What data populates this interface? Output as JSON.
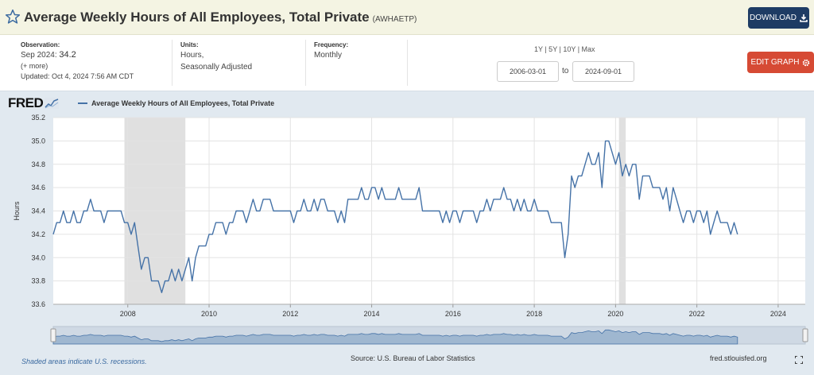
{
  "header": {
    "title": "Average Weekly Hours of All Employees, Total Private",
    "series_id": "(AWHAETP)",
    "download_label": "DOWNLOAD"
  },
  "meta": {
    "observation_label": "Observation:",
    "observation_period": "Sep 2024:",
    "observation_value": "34.2",
    "more_label": "(+ more)",
    "updated": "Updated: Oct 4, 2024 7:56 AM CDT",
    "units_label": "Units:",
    "units_line1": "Hours,",
    "units_line2": "Seasonally Adjusted",
    "frequency_label": "Frequency:",
    "frequency_value": "Monthly",
    "ranges": "1Y | 5Y | 10Y | Max",
    "date_from": "2006-03-01",
    "to_label": "to",
    "date_to": "2024-09-01",
    "edit_label": "EDIT GRAPH"
  },
  "chart": {
    "logo_text": "FRED",
    "legend_label": "Average Weekly Hours of All Employees, Total Private",
    "footer_recessions": "Shaded areas indicate U.S. recessions.",
    "footer_source": "Source: U.S. Bureau of Labor Statistics",
    "footer_site": "fred.stlouisfed.org"
  },
  "colors": {
    "line": "#4572a7",
    "recession": "#e0e0e0",
    "download_button": "#1e3c64",
    "edit_button": "#d64a34",
    "chart_background": "#e1e9f0"
  },
  "chart_data": {
    "type": "line",
    "ylabel": "Hours",
    "xlabel": "",
    "ylim": [
      33.6,
      35.2
    ],
    "yticks": [
      "33.6",
      "33.8",
      "34.0",
      "34.2",
      "34.4",
      "34.6",
      "34.8",
      "35.0",
      "35.2"
    ],
    "xticks": [
      "2008",
      "2010",
      "2012",
      "2014",
      "2016",
      "2018",
      "2020",
      "2022",
      "2024"
    ],
    "x_range": [
      "2006-03",
      "2024-09"
    ],
    "recessions": [
      [
        "2007-12",
        "2009-06"
      ],
      [
        "2020-02",
        "2020-04"
      ]
    ],
    "grid": true,
    "series": [
      {
        "name": "Average Weekly Hours of All Employees, Total Private",
        "x_start": "2006-03",
        "frequency": "monthly",
        "values": [
          34.2,
          34.3,
          34.3,
          34.4,
          34.3,
          34.3,
          34.4,
          34.3,
          34.3,
          34.4,
          34.4,
          34.5,
          34.4,
          34.4,
          34.4,
          34.3,
          34.4,
          34.4,
          34.4,
          34.4,
          34.4,
          34.3,
          34.3,
          34.2,
          34.3,
          34.1,
          33.9,
          34.0,
          34.0,
          33.8,
          33.8,
          33.8,
          33.7,
          33.8,
          33.8,
          33.9,
          33.8,
          33.9,
          33.8,
          33.9,
          34.0,
          33.8,
          34.0,
          34.1,
          34.1,
          34.1,
          34.2,
          34.2,
          34.3,
          34.3,
          34.3,
          34.2,
          34.3,
          34.3,
          34.4,
          34.4,
          34.4,
          34.3,
          34.4,
          34.5,
          34.4,
          34.4,
          34.5,
          34.5,
          34.5,
          34.4,
          34.4,
          34.4,
          34.4,
          34.4,
          34.4,
          34.3,
          34.4,
          34.4,
          34.5,
          34.4,
          34.4,
          34.5,
          34.4,
          34.5,
          34.5,
          34.4,
          34.4,
          34.4,
          34.3,
          34.4,
          34.3,
          34.5,
          34.5,
          34.5,
          34.5,
          34.6,
          34.5,
          34.5,
          34.6,
          34.6,
          34.5,
          34.6,
          34.5,
          34.5,
          34.5,
          34.5,
          34.6,
          34.5,
          34.5,
          34.5,
          34.5,
          34.5,
          34.6,
          34.4,
          34.4,
          34.4,
          34.4,
          34.4,
          34.4,
          34.3,
          34.4,
          34.3,
          34.4,
          34.4,
          34.3,
          34.4,
          34.4,
          34.4,
          34.4,
          34.3,
          34.4,
          34.4,
          34.5,
          34.4,
          34.5,
          34.5,
          34.5,
          34.6,
          34.5,
          34.5,
          34.4,
          34.5,
          34.4,
          34.5,
          34.4,
          34.4,
          34.5,
          34.4,
          34.4,
          34.4,
          34.4,
          34.3,
          34.3,
          34.3,
          34.3,
          34.0,
          34.2,
          34.7,
          34.6,
          34.7,
          34.7,
          34.8,
          34.9,
          34.8,
          34.8,
          34.9,
          34.6,
          35.0,
          35.0,
          34.9,
          34.8,
          34.9,
          34.7,
          34.8,
          34.7,
          34.8,
          34.8,
          34.5,
          34.7,
          34.7,
          34.7,
          34.6,
          34.6,
          34.6,
          34.5,
          34.6,
          34.4,
          34.6,
          34.5,
          34.4,
          34.3,
          34.4,
          34.4,
          34.3,
          34.4,
          34.4,
          34.3,
          34.4,
          34.2,
          34.3,
          34.4,
          34.3,
          34.3,
          34.3,
          34.2,
          34.3,
          34.2
        ]
      }
    ]
  }
}
